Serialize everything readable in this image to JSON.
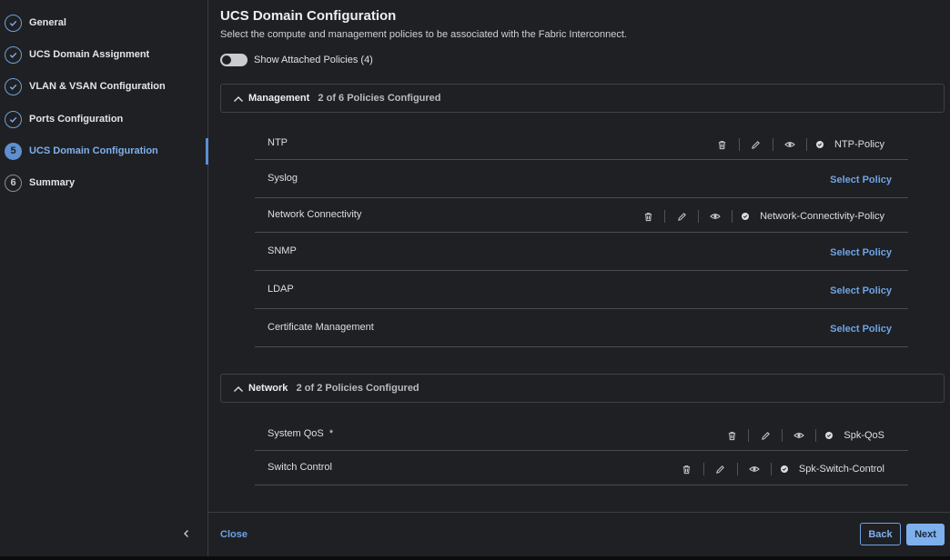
{
  "sidebar": {
    "steps": [
      {
        "label": "General",
        "status": "done"
      },
      {
        "label": "UCS Domain Assignment",
        "status": "done"
      },
      {
        "label": "VLAN & VSAN Configuration",
        "status": "done"
      },
      {
        "label": "Ports Configuration",
        "status": "done"
      },
      {
        "label": "UCS Domain Configuration",
        "status": "active",
        "number": "5"
      },
      {
        "label": "Summary",
        "status": "pending",
        "number": "6"
      }
    ]
  },
  "main": {
    "title": "UCS Domain Configuration",
    "subtitle": "Select the compute and management policies to be associated with the Fabric Interconnect.",
    "toggle_label": "Show Attached Policies (4)",
    "toggle_on": false,
    "management": {
      "name": "Management",
      "count": "2 of 6 Policies Configured",
      "rows": [
        {
          "name": "NTP",
          "policy": "NTP-Policy"
        },
        {
          "name": "Syslog",
          "action": "Select Policy"
        },
        {
          "name": "Network Connectivity",
          "policy": "Network-Connectivity-Policy"
        },
        {
          "name": "SNMP",
          "action": "Select Policy"
        },
        {
          "name": "LDAP",
          "action": "Select Policy"
        },
        {
          "name": "Certificate Management",
          "action": "Select Policy"
        }
      ]
    },
    "network": {
      "name": "Network",
      "count": "2 of 2 Policies Configured",
      "rows": [
        {
          "name": "System QoS",
          "required_mark": "*",
          "policy": "Spk-QoS"
        },
        {
          "name": "Switch Control",
          "policy": "Spk-Switch-Control"
        }
      ]
    }
  },
  "footer": {
    "close": "Close",
    "back": "Back",
    "next": "Next"
  },
  "colors": {
    "accent": "#6fa3e6",
    "background": "#1f2023"
  },
  "icons": [
    "check-icon",
    "chevron-up-icon",
    "chevron-left-icon",
    "trash-icon",
    "pencil-icon",
    "eye-icon"
  ]
}
